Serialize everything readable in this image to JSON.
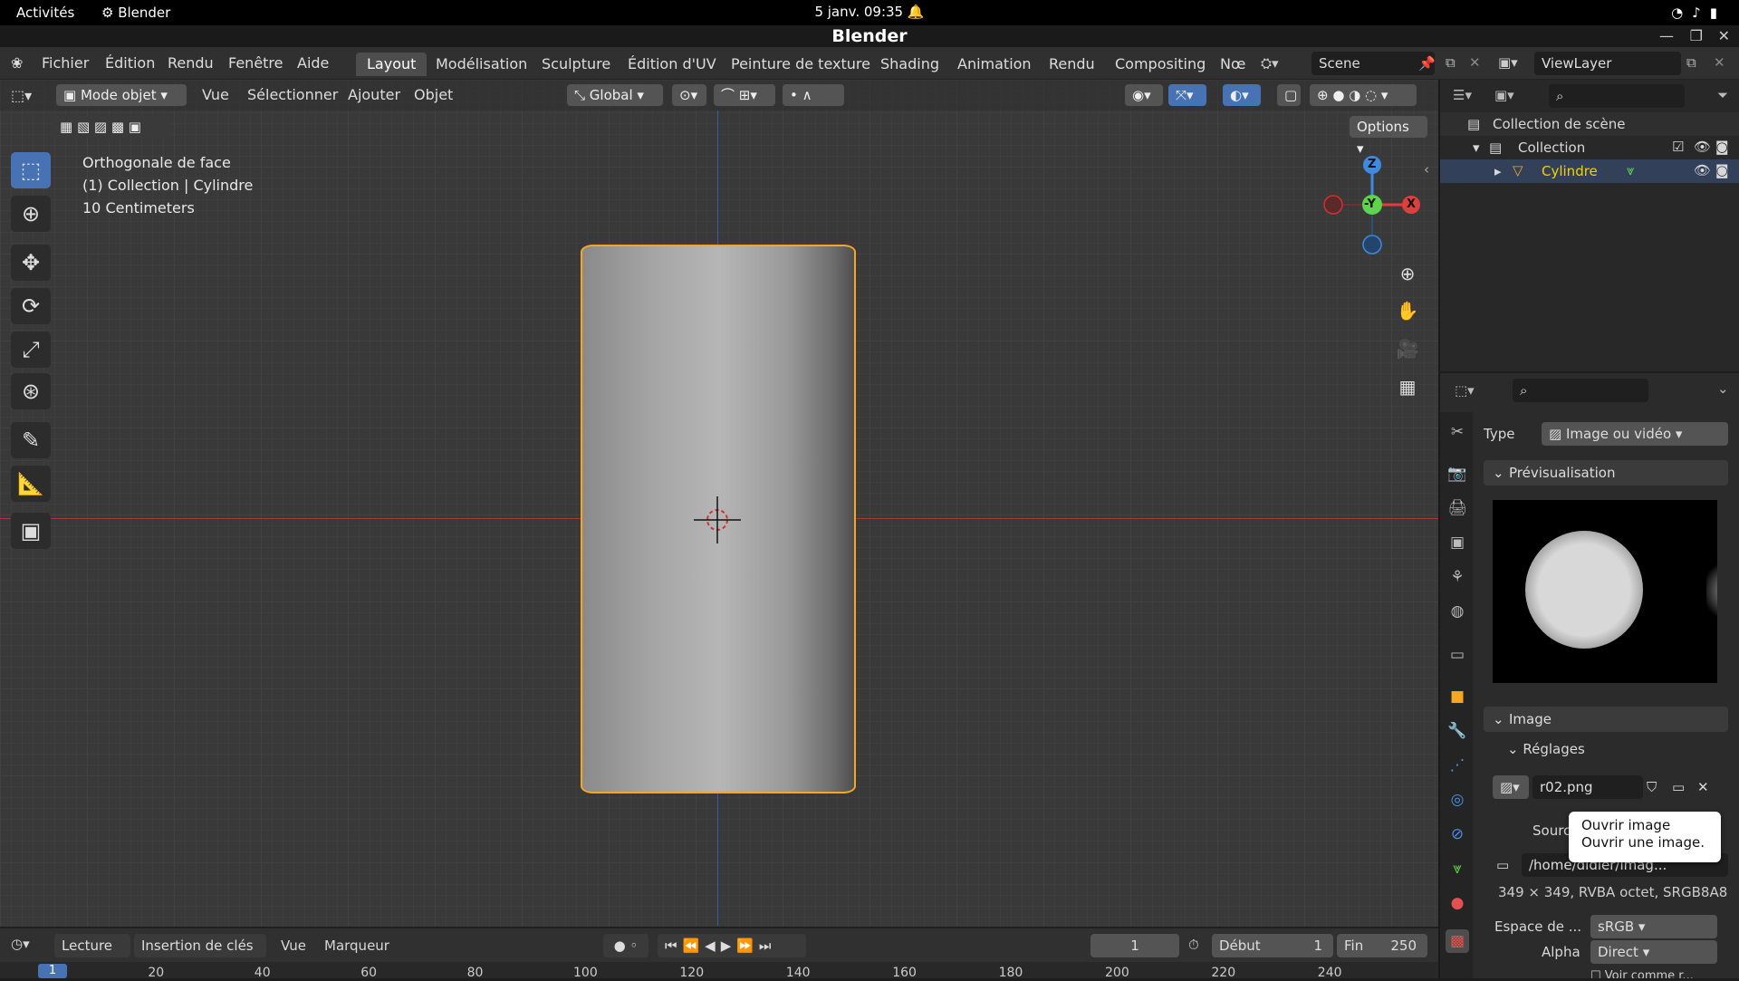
{
  "gnome": {
    "activities": "Activités",
    "app": "Blender",
    "clock": "5 janv. 09:35"
  },
  "window": {
    "title": "Blender"
  },
  "menu": [
    "Fichier",
    "Édition",
    "Rendu",
    "Fenêtre",
    "Aide"
  ],
  "workspaces": [
    "Layout",
    "Modélisation",
    "Sculpture",
    "Édition d'UV",
    "Peinture de texture",
    "Shading",
    "Animation",
    "Rendu",
    "Compositing",
    "Nœ"
  ],
  "scene": {
    "name": "Scene",
    "view_layer": "ViewLayer"
  },
  "viewport_header": {
    "mode": "Mode objet",
    "menus": [
      "Vue",
      "Sélectionner",
      "Ajouter",
      "Objet"
    ],
    "orientation": "Global",
    "options": "Options"
  },
  "overlay": {
    "view": "Orthogonale de face",
    "collection": "(1) Collection | Cylindre",
    "scale": "10 Centimeters"
  },
  "gizmo": {
    "z": "Z",
    "y": "-Y",
    "x": "X"
  },
  "outliner": {
    "scene_collection": "Collection de scène",
    "collection": "Collection",
    "object": "Cylindre"
  },
  "properties": {
    "type_label": "Type",
    "type_value": "Image ou vidéo",
    "preview_header": "Prévisualisation",
    "image_header": "Image",
    "settings_header": "Réglages",
    "image_name": "r02.png",
    "source_label": "Sourc",
    "filepath": "/home/didier/imag...",
    "info": "349 × 349, RVBA octet, SRGB8A8",
    "colorspace_label": "Espace de ...",
    "colorspace_value": "sRGB",
    "alpha_label": "Alpha",
    "alpha_value": "Direct",
    "view_as": "Voir comme r..."
  },
  "tooltip": {
    "line1": "Ouvrir image",
    "line2": "Ouvrir une image."
  },
  "timeline": {
    "playback": "Lecture",
    "keying": "Insertion de clés",
    "view": "Vue",
    "marker": "Marqueur",
    "current_frame": "1",
    "start_label": "Début",
    "start": "1",
    "end_label": "Fin",
    "end": "250",
    "ticks": [
      "20",
      "40",
      "60",
      "80",
      "100",
      "120",
      "140",
      "160",
      "180",
      "200",
      "220",
      "240"
    ],
    "playhead": "1"
  },
  "colors": {
    "selection": "#f5a623",
    "active_tool": "#4772b3",
    "axis_x": "#e23d3d",
    "axis_y": "#5fd34a",
    "axis_z": "#3d8ae0"
  }
}
